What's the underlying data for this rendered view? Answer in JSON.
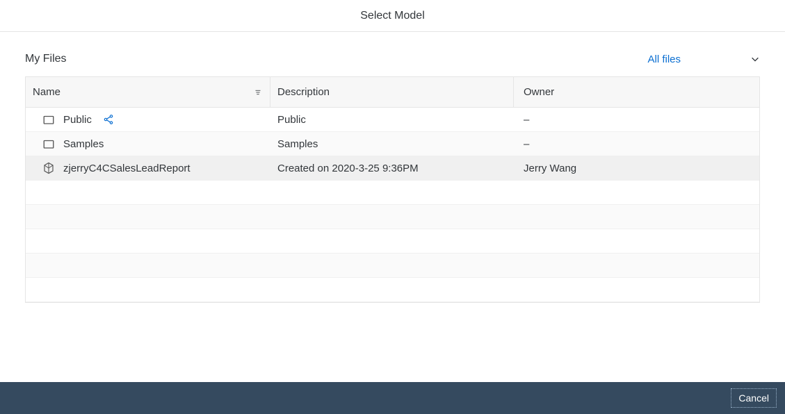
{
  "dialog": {
    "title": "Select Model"
  },
  "breadcrumb": {
    "label": "My Files"
  },
  "filter": {
    "label": "All files"
  },
  "table": {
    "columns": {
      "name": "Name",
      "description": "Description",
      "owner": "Owner"
    },
    "rows": [
      {
        "icon": "folder",
        "name": "Public",
        "shared": true,
        "description": "Public",
        "owner": "–"
      },
      {
        "icon": "folder",
        "name": "Samples",
        "shared": false,
        "description": "Samples",
        "owner": "–"
      },
      {
        "icon": "model",
        "name": "zjerryC4CSalesLeadReport",
        "shared": false,
        "description": "Created on 2020-3-25 9:36PM",
        "owner": "Jerry Wang"
      }
    ]
  },
  "footer": {
    "cancel": "Cancel"
  }
}
